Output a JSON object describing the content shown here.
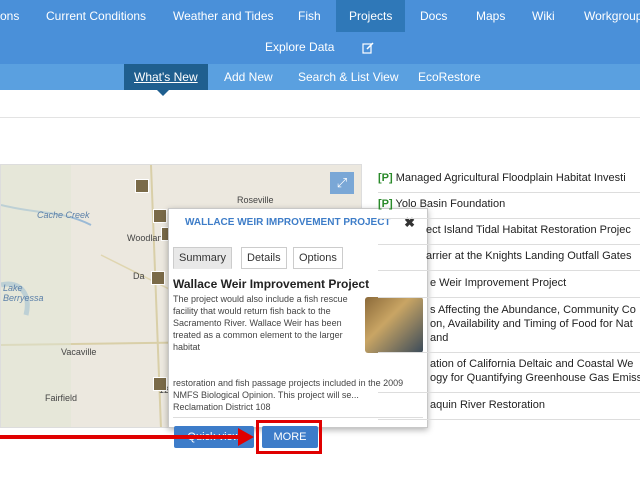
{
  "top_nav": {
    "items": [
      {
        "label": "ons"
      },
      {
        "label": "Current Conditions"
      },
      {
        "label": "Weather and Tides"
      },
      {
        "label": "Fish"
      },
      {
        "label": "Projects"
      },
      {
        "label": "Docs"
      },
      {
        "label": "Maps"
      },
      {
        "label": "Wiki"
      },
      {
        "label": "Workgroup"
      }
    ],
    "explore_label": "Explore Data",
    "edit_icon": "edit-icon"
  },
  "sub_nav": {
    "items": [
      {
        "label": "What's New"
      },
      {
        "label": "Add New"
      },
      {
        "label": "Search & List View"
      },
      {
        "label": "EcoRestore"
      }
    ]
  },
  "map": {
    "labels": [
      {
        "text": "Roseville"
      },
      {
        "text": "Cache Creek"
      },
      {
        "text": "Woodland"
      },
      {
        "text": "Da"
      },
      {
        "text": "Lake"
      },
      {
        "text": "Berryessa"
      },
      {
        "text": "Vacaville"
      },
      {
        "text": "Fairfield"
      },
      {
        "text": "12"
      }
    ],
    "expand_icon": "expand-icon"
  },
  "popup": {
    "title": "WALLACE WEIR IMPROVEMENT PROJECT",
    "close": "✖",
    "tabs": [
      {
        "label": "Summary"
      },
      {
        "label": "Details"
      },
      {
        "label": "Options"
      }
    ],
    "heading": "Wallace Weir Improvement Project",
    "text_a": "The project would also include a fish rescue facility that would return fish back to the Sacramento River. Wallace Weir has been treated as a common element to the larger habitat",
    "text_b": "restoration and fish passage projects included in the 2009 NMFS Biological Opinion. This project will se...",
    "agency": "Reclamation District 108",
    "quick_view_label": "Quick view",
    "more_label": "MORE"
  },
  "project_list": [
    {
      "tag": "[P]",
      "text": " Managed Agricultural Floodplain Habitat Investi"
    },
    {
      "tag": "[P]",
      "text": " Yolo Basin Foundation"
    },
    {
      "tag": "",
      "text": "ect Island Tidal Habitat Restoration Projec"
    },
    {
      "tag": "",
      "text": "arrier at the Knights Landing Outfall Gates"
    },
    {
      "tag": "",
      "text": "e Weir Improvement Project"
    },
    {
      "tag": "",
      "text": "s Affecting the Abundance, Community Co"
    },
    {
      "tag": "",
      "text": "on, Availability and Timing of Food for Nat"
    },
    {
      "tag": "",
      "text": "and"
    },
    {
      "tag": "",
      "text": "ation of California Deltaic and Coastal We"
    },
    {
      "tag": "",
      "text": "ogy for Quantifying Greenhouse Gas Emiss"
    },
    {
      "tag": "",
      "text": "aquin River Restoration"
    }
  ],
  "colors": {
    "nav": "#4a90d9",
    "subnav": "#5aa0e0",
    "active": "#1f5f8f",
    "annotation": "#e00000"
  }
}
